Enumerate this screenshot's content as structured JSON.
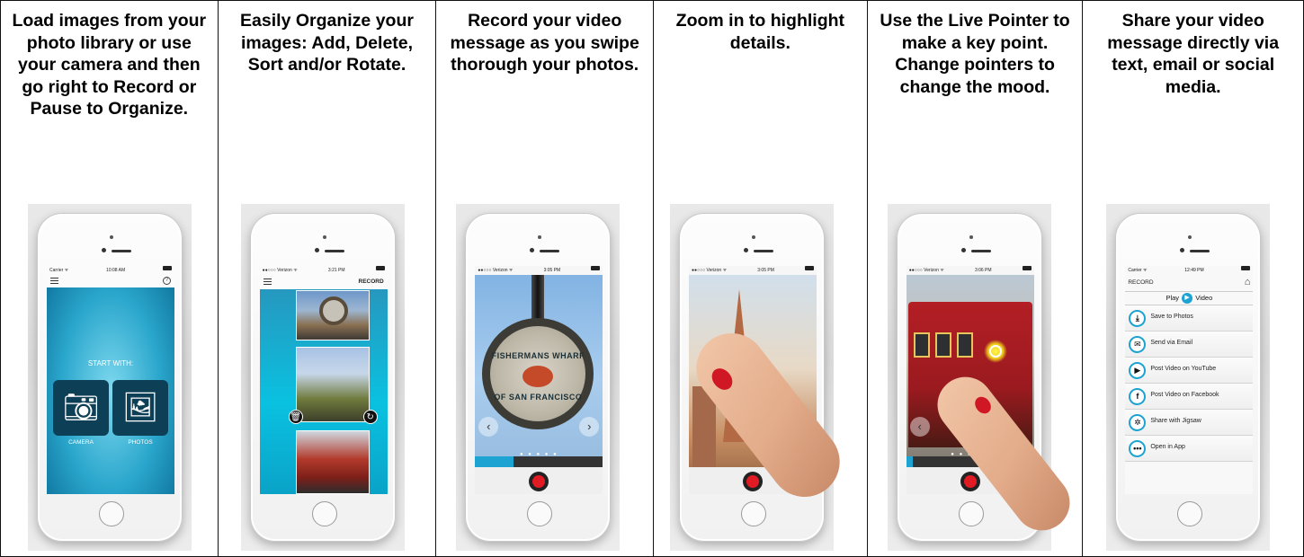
{
  "panels": [
    {
      "caption": "Load images from your photo library or use your camera and then go right to Record or Pause to Organize.",
      "screen": {
        "carrier": "Carrier ᯤ",
        "time": "10:08 AM",
        "start_with": "START WITH:",
        "camera_label": "CAMERA",
        "photos_label": "PHOTOS"
      }
    },
    {
      "caption": "Easily Organize your images: Add, Delete, Sort and/or Rotate.",
      "screen": {
        "carrier": "●●○○○ Verizon ᯤ",
        "time": "3:21 PM",
        "record": "RECORD"
      }
    },
    {
      "caption": "Record your video message as you swipe thorough your photos.",
      "screen": {
        "carrier": "●●○○○ Verizon ᯤ",
        "time": "3:05 PM",
        "sign_text": "FISHERMANS WHARF",
        "sign_text_bottom": "OF SAN FRANCISCO",
        "progress": 0.3
      }
    },
    {
      "caption": "Zoom in to highlight details.",
      "screen": {
        "carrier": "●●○○○ Verizon ᯤ",
        "time": "3:05 PM"
      }
    },
    {
      "caption": "Use the Live Pointer to make a key point. Change pointers to change the mood.",
      "screen": {
        "carrier": "●●○○○ Verizon ᯤ",
        "time": "3:06 PM",
        "progress": 0.05
      }
    },
    {
      "caption": "Share your video message directly via text, email or social media.",
      "screen": {
        "carrier": "Carrier ᯤ",
        "time": "12:49 PM",
        "record": "RECORD",
        "play_left": "Play",
        "play_right": "Video",
        "options": [
          {
            "label": "Save to Photos",
            "icon": "download-icon",
            "glyph": "⤓"
          },
          {
            "label": "Send via Email",
            "icon": "email-icon",
            "glyph": "✉"
          },
          {
            "label": "Post Video on YouTube",
            "icon": "youtube-icon",
            "glyph": "▶"
          },
          {
            "label": "Post Video on Facebook",
            "icon": "facebook-icon",
            "glyph": "f"
          },
          {
            "label": "Share with Jigsaw",
            "icon": "jigsaw-icon",
            "glyph": "✲"
          },
          {
            "label": "Open in App",
            "icon": "more-icon",
            "glyph": "•••"
          }
        ]
      }
    }
  ],
  "colors": {
    "accent": "#1da3d1",
    "record_red": "#e01b24",
    "nail_red": "#d01824"
  }
}
